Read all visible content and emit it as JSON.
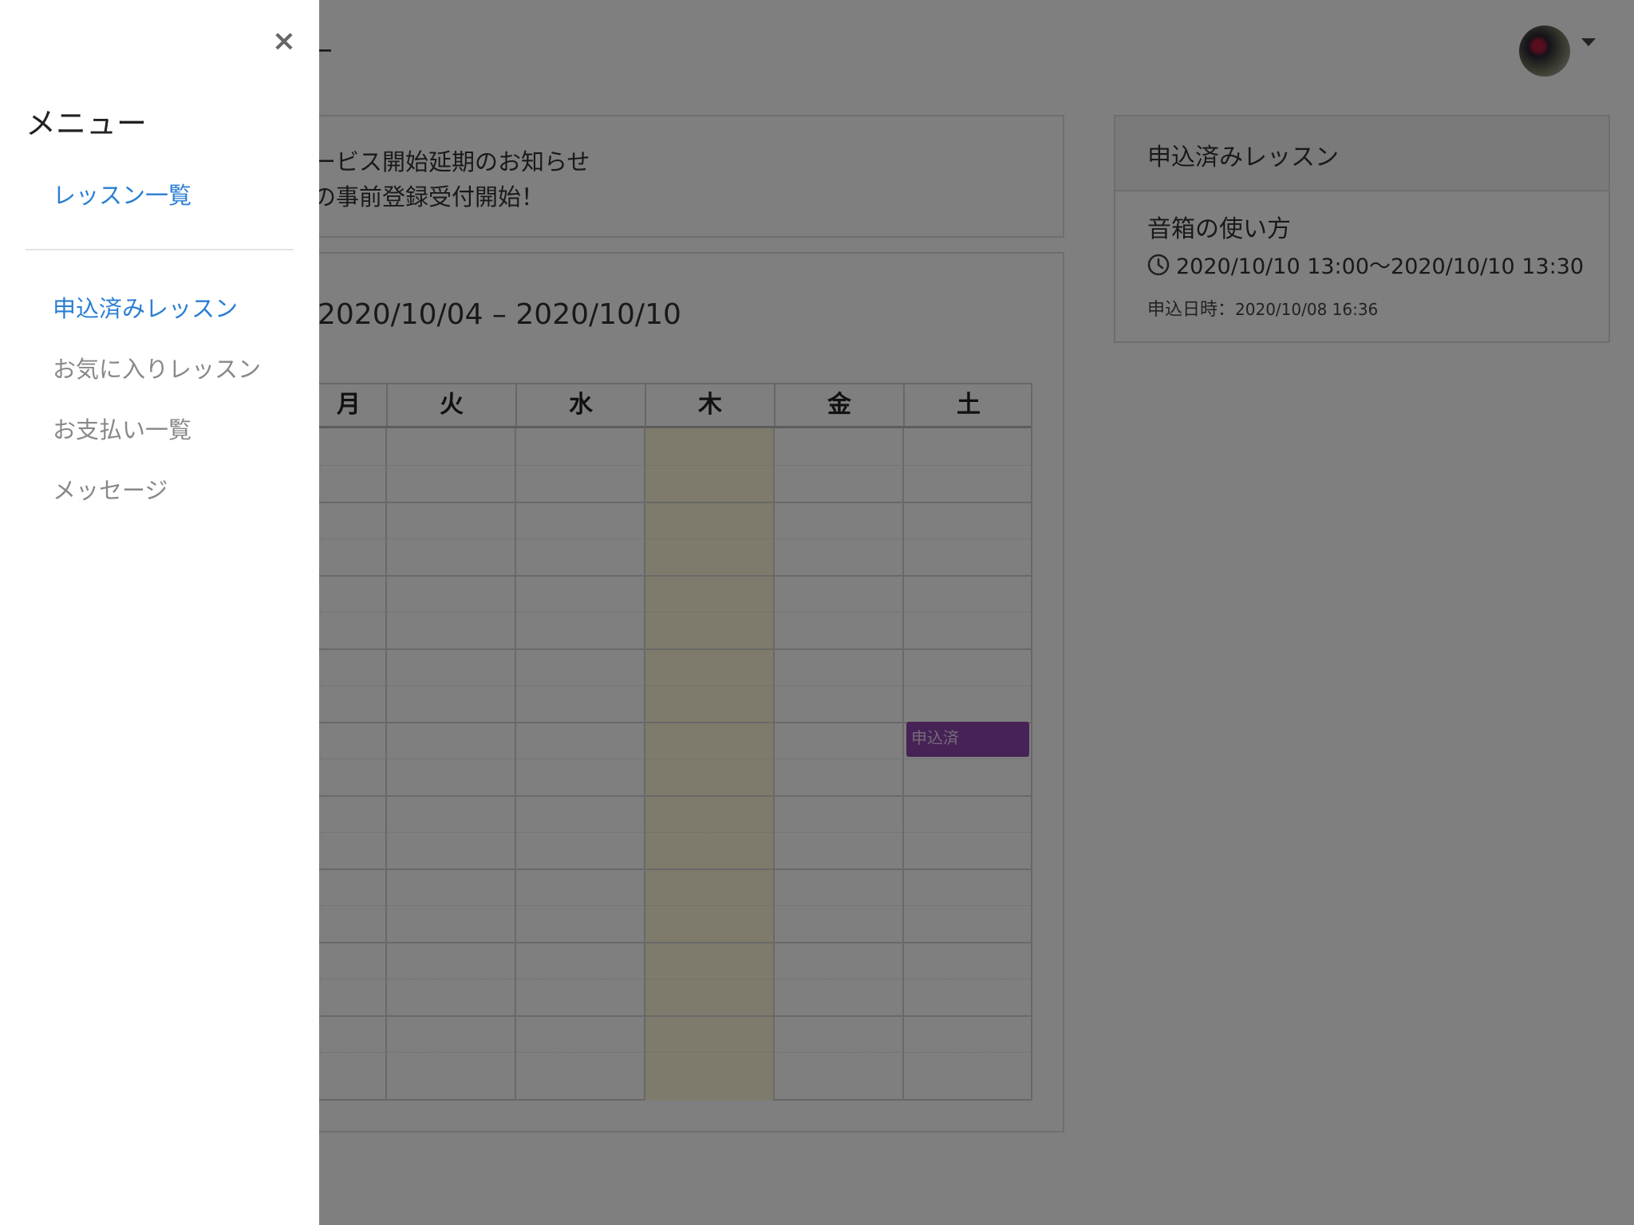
{
  "header": {
    "title_fragment": "ー"
  },
  "notices": [
    "ービス開始延期のお知らせ",
    "の事前登録受付開始！"
  ],
  "calendar": {
    "range": "2020/10/04 – 2020/10/10",
    "days": [
      "月",
      "火",
      "水",
      "木",
      "金",
      "土"
    ],
    "today_index": 3,
    "event": {
      "label": "申込済",
      "day_index": 5,
      "color": "#8e44ad"
    }
  },
  "side": {
    "title": "申込済みレッスン",
    "lesson_name": "音箱の使い方",
    "lesson_time": "2020/10/10 13:00〜2020/10/10 13:30",
    "applied_label": "申込日時：",
    "applied_value": "2020/10/08 16:36"
  },
  "drawer": {
    "close_icon": "close-icon",
    "title": "メニュー",
    "items": [
      {
        "label": "レッスン一覧",
        "active": true
      },
      {
        "label": "申込済みレッスン",
        "active": true
      },
      {
        "label": "お気に入りレッスン",
        "active": false
      },
      {
        "label": "お支払い一覧",
        "active": false
      },
      {
        "label": "メッセージ",
        "active": false
      }
    ]
  },
  "colors": {
    "accent": "#2a7ed3",
    "today": "#fdf7d8",
    "event": "#8e44ad"
  }
}
